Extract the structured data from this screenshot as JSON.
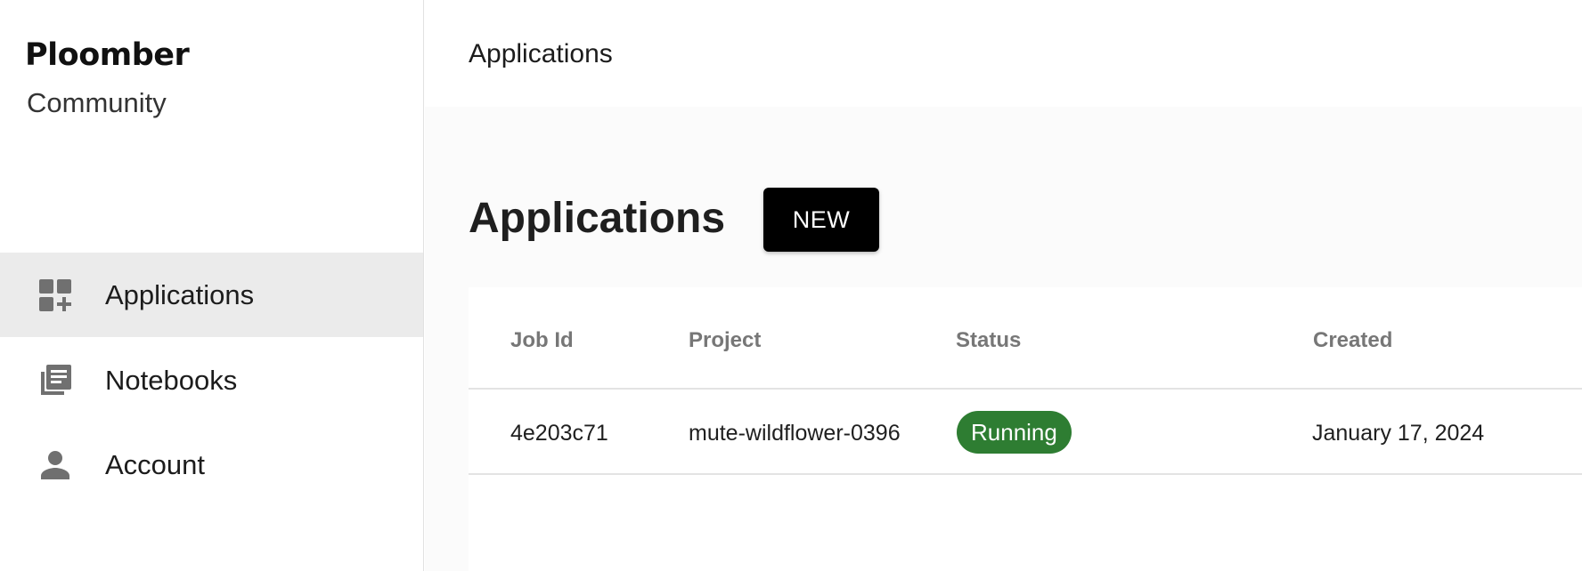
{
  "brand": {
    "name": "Ploomber",
    "edition": "Community"
  },
  "sidebar": {
    "items": [
      {
        "label": "Applications",
        "icon": "add-dashboard-icon",
        "active": true
      },
      {
        "label": "Notebooks",
        "icon": "library-books-icon",
        "active": false
      },
      {
        "label": "Account",
        "icon": "person-icon",
        "active": false
      }
    ]
  },
  "topbar": {
    "title": "Applications"
  },
  "main": {
    "title": "Applications",
    "new_button": "NEW",
    "table": {
      "columns": [
        "Job Id",
        "Project",
        "Status",
        "Created"
      ],
      "rows": [
        {
          "job_id": "4e203c71",
          "project": "mute-wildflower-0396",
          "status": "Running",
          "created": "January 17, 2024"
        }
      ]
    }
  },
  "colors": {
    "status_running": "#2e7d32",
    "active_nav_bg": "#ebebeb",
    "button_bg": "#000000",
    "icon": "#707070"
  }
}
